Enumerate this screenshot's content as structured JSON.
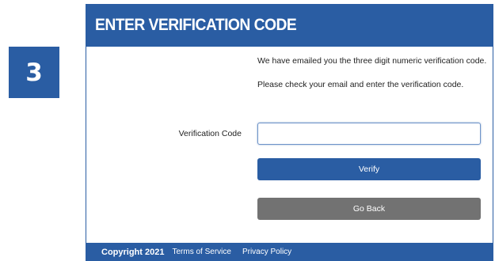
{
  "step": {
    "number": "3"
  },
  "panel": {
    "title": "ENTER VERIFICATION CODE",
    "message_line1": "We have emailed you the three digit numeric verification code.",
    "message_line2": "Please check your email and enter the verification code."
  },
  "form": {
    "code_label": "Verification Code",
    "code_value": "",
    "verify_label": "Verify",
    "back_label": "Go Back"
  },
  "footer": {
    "copyright": "Copyright 2021",
    "terms_label": "Terms of Service",
    "privacy_label": "Privacy Policy"
  },
  "colors": {
    "brand_blue": "#2a5da3",
    "back_button_gray": "#727272"
  }
}
